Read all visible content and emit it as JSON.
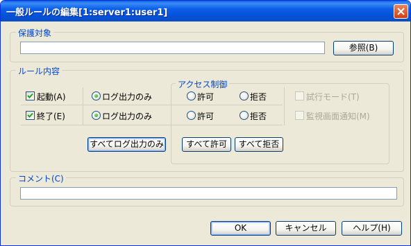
{
  "window": {
    "title": "一般ルールの編集[1:server1:user1]"
  },
  "protect_target": {
    "legend": "保護対象",
    "value": "",
    "browse_label": "参照(B)"
  },
  "rule_contents": {
    "legend": "ルール内容",
    "access_control_legend": "アクセス制御",
    "rows": [
      {
        "label": "起動(A)",
        "checked": true,
        "radio_log": "ログ出力のみ",
        "radio_allow": "許可",
        "radio_deny": "拒否",
        "selected": "log"
      },
      {
        "label": "終了(E)",
        "checked": true,
        "radio_log": "ログ出力のみ",
        "radio_allow": "許可",
        "radio_deny": "拒否",
        "selected": "log"
      }
    ],
    "trial_mode_label": "試行モード(T)",
    "monitor_notify_label": "監視画面通知(M)",
    "all_log_button": "すべてログ出力のみ",
    "all_allow_button": "すべて許可",
    "all_deny_button": "すべて拒否"
  },
  "comment": {
    "legend": "コメント(C)",
    "value": ""
  },
  "footer": {
    "ok_label": "OK",
    "cancel_label": "キャンセル",
    "help_label": "ヘルプ(H)"
  }
}
